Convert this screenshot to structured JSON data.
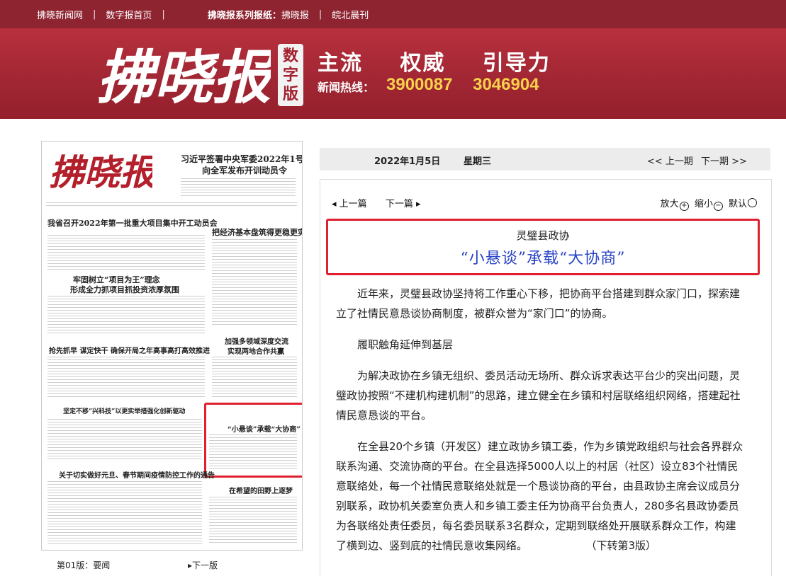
{
  "topnav": {
    "items": [
      "拂晓新闻网",
      "数字报首页"
    ],
    "series_label": "拂晓报系列报纸：",
    "papers": [
      "拂晓报",
      "皖北晨刊"
    ]
  },
  "banner": {
    "logo_text": "拂晓报",
    "badge": [
      "数",
      "字",
      "版"
    ],
    "slogan": [
      "主流",
      "权威",
      "引导力"
    ],
    "hotline_label": "新闻热线：",
    "phones": [
      "3900087",
      "3046904"
    ]
  },
  "thumbnail": {
    "masthead": "拂晓报",
    "headlines": [
      "习近平签署中央军委2022年1号命令",
      "向全军发布开训动员令",
      "我省召开2022年第一批重大项目集中开工动员会",
      "把经济基本盘筑得更稳更实",
      "牢固树立“项目为王”理念",
      "形成全力抓项目抓投资浓厚氛围",
      "抢先抓早 谋定快干 确保开局之年高事高打高效推进",
      "加强多领域深度交流",
      "实现两地合作共赢",
      "坚定不移“兴科技”以更实举措强化创新驱动",
      "“小悬谈”承载“大协商”",
      "关于切实做好元旦、春节期间疫情防控工作的通告",
      "在希望的田野上逐梦"
    ],
    "page_label": "第01版：要闻",
    "next_label": "下一版"
  },
  "datebar": {
    "date": "2022年1月5日",
    "weekday": "星期三",
    "prev": "<< 上一期",
    "next": "下一期 >>"
  },
  "article": {
    "prev": "上一篇",
    "next": "下一篇",
    "zoom_in": "放大",
    "zoom_out": "缩小",
    "default": "默认",
    "kicker": "灵璧县政协",
    "headline": "“小悬谈”承载“大协商”",
    "paragraphs": [
      "近年来，灵璧县政协坚持将工作重心下移，把协商平台搭建到群众家门口，探索建立了社情民意恳谈协商制度，被群众誉为“家门口”的协商。",
      "履职触角延伸到基层",
      "为解决政协在乡镇无组织、委员活动无场所、群众诉求表达平台少的突出问题，灵璧政协按照“不建机构建机制”的思路，建立健全在乡镇和村居联络组织网络，搭建起社情民意恳谈的平台。",
      "在全县20个乡镇（开发区）建立政协乡镇工委，作为乡镇党政组织与社会各界群众联系沟通、交流协商的平台。在全县选择5000人以上的村居（社区）设立83个社情民意联络处，每一个社情民意联络处就是一个恳谈协商的平台，由县政协主席会议成员分别联系，政协机关委室负责人和乡镇工委主任为协商平台负责人，280多名县政协委员为各联络处责任委员，每名委员联系3名群众，定期到联络处开展联系群众工作，构建了横到边、竖到底的社情民意收集网络。"
    ],
    "continued": "（下转第3版）"
  }
}
